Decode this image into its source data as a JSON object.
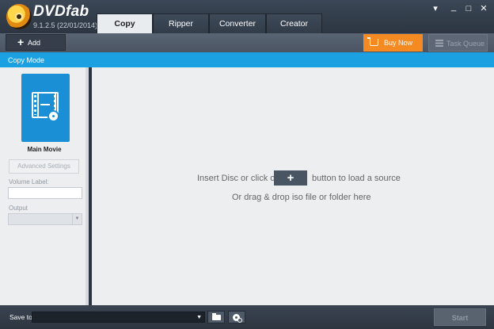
{
  "app": {
    "brand": "DVDfab",
    "version": "9.1.2.5 (22/01/2014)",
    "logo_icon": "dvdfab-logo-icon"
  },
  "tabs": [
    {
      "label": "Copy",
      "active": true
    },
    {
      "label": "Ripper",
      "active": false
    },
    {
      "label": "Converter",
      "active": false
    },
    {
      "label": "Creator",
      "active": false
    }
  ],
  "window_controls": {
    "menu_icon": "dropdown-menu-icon",
    "minimize_icon": "minimize-icon",
    "maximize_icon": "maximize-icon",
    "close_icon": "close-icon",
    "menu_glyph": "▾",
    "minimize_glyph": "_",
    "maximize_glyph": "□",
    "close_glyph": "✕"
  },
  "toolbar": {
    "add_label": "Add",
    "buy_label": "Buy Now",
    "queue_label": "Task Queue",
    "buy_color": "#f58a22"
  },
  "mode_bar": {
    "label": "Copy Mode",
    "color": "#1ba1e2"
  },
  "left_panel": {
    "mode_title": "Main Movie",
    "advanced_label": "Advanced Settings",
    "volume_label": "Volume Label:",
    "volume_value": "",
    "output_label": "Output",
    "output_value": "",
    "card_color": "#1b8fd6"
  },
  "main": {
    "hint_before": "Insert Disc or click on",
    "hint_after": "button to load a source",
    "hint_drag": "Or drag & drop iso file or folder here",
    "plus_glyph": "+"
  },
  "bottom": {
    "save_label": "Save to:",
    "save_value": "",
    "start_label": "Start",
    "folder_icon": "folder-icon",
    "disc_icon": "disc-settings-icon"
  }
}
